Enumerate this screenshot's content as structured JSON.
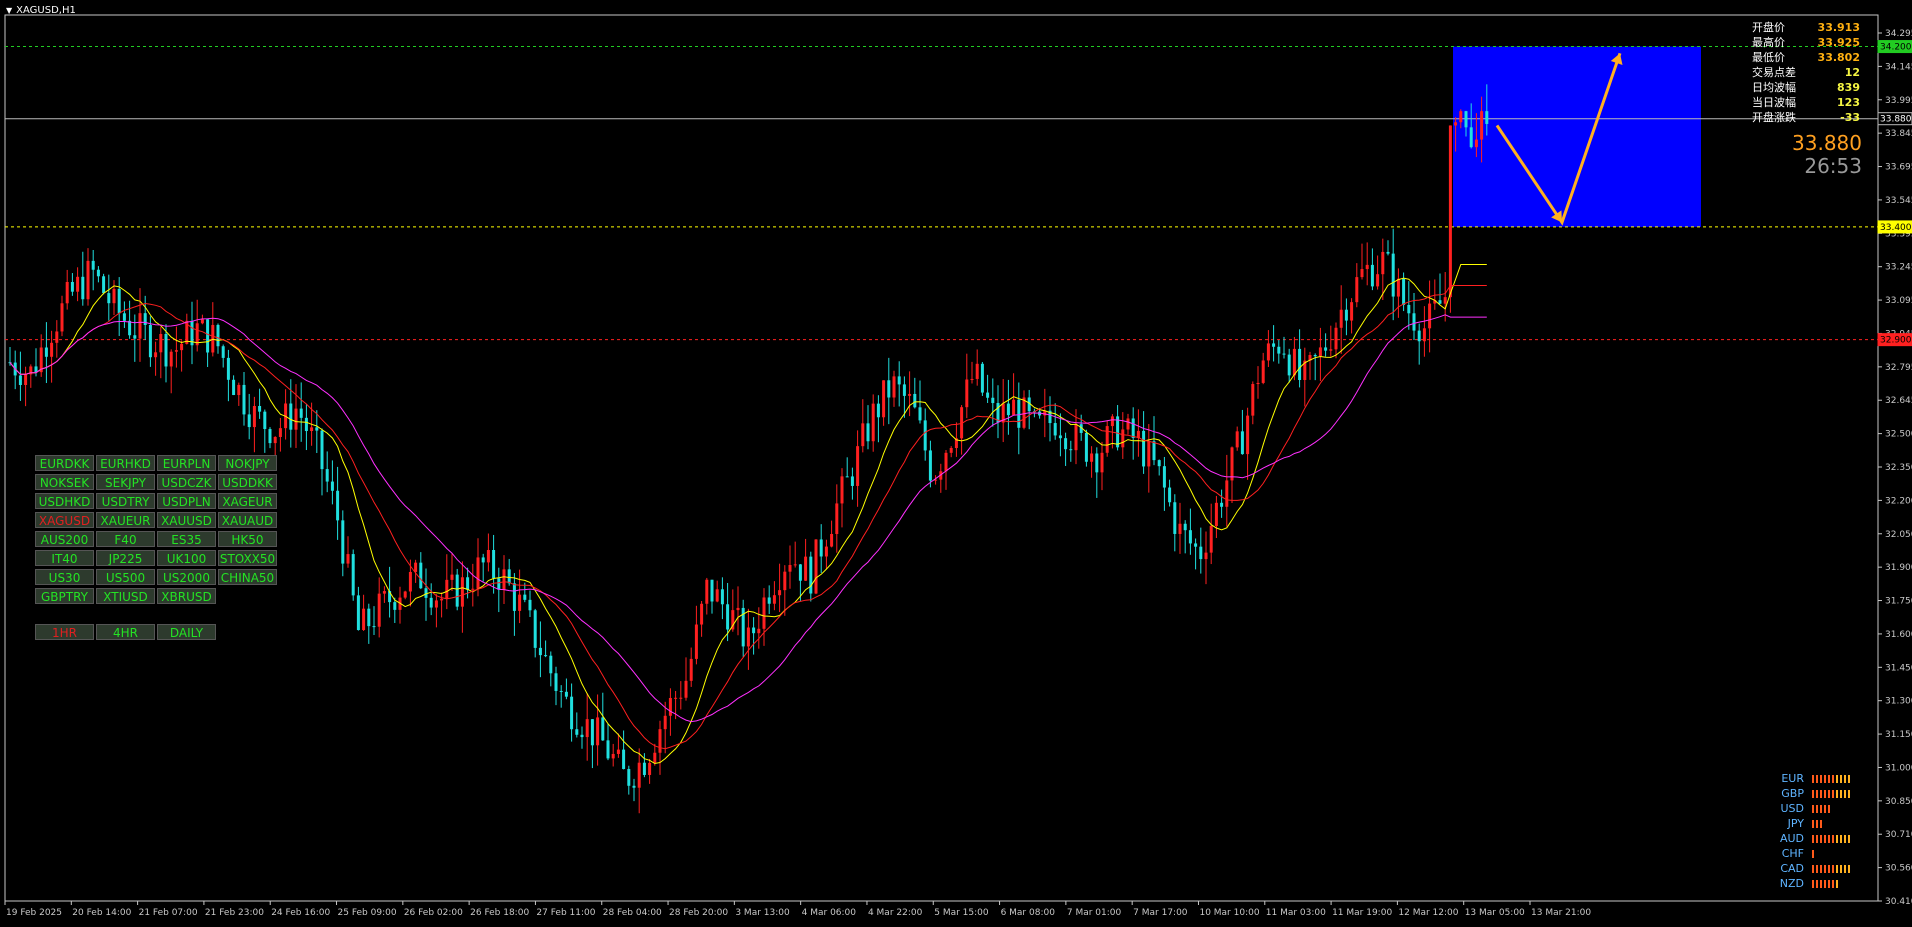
{
  "window": {
    "title": "XAGUSD,H1"
  },
  "info_panel": {
    "rows": [
      {
        "label": "开盘价",
        "value": "33.913",
        "color": "#ffb010"
      },
      {
        "label": "最高价",
        "value": "33.925",
        "color": "#ffb010"
      },
      {
        "label": "最低价",
        "value": "33.802",
        "color": "#ffb010"
      },
      {
        "label": "交易点差",
        "value": "12",
        "color": "#f5f542"
      },
      {
        "label": "日均波幅",
        "value": "839",
        "color": "#f5f542"
      },
      {
        "label": "当日波幅",
        "value": "123",
        "color": "#f5f542"
      },
      {
        "label": "开盘涨跌",
        "value": "-33",
        "color": "#f5f542"
      }
    ],
    "current_price": "33.880",
    "bar_timer": "26:53"
  },
  "symbols": [
    "EURDKK",
    "EURHKD",
    "EURPLN",
    "NOKJPY",
    "NOKSEK",
    "SEKJPY",
    "USDCZK",
    "USDDKK",
    "USDHKD",
    "USDTRY",
    "USDPLN",
    "XAGEUR",
    "XAGUSD",
    "XAUEUR",
    "XAUUSD",
    "XAUAUD",
    "AUS200",
    "F40",
    "ES35",
    "HK50",
    "IT40",
    "JP225",
    "UK100",
    "STOXX50",
    "US30",
    "US500",
    "US2000",
    "CHINA50",
    "GBPTRY",
    "XTIUSD",
    "XBRUSD"
  ],
  "active_symbol": "XAGUSD",
  "timeframes": [
    "1HR",
    "4HR",
    "DAILY"
  ],
  "active_timeframe": "1HR",
  "currency_strength": [
    {
      "name": "EUR",
      "level": 10
    },
    {
      "name": "GBP",
      "level": 10
    },
    {
      "name": "USD",
      "level": 5
    },
    {
      "name": "JPY",
      "level": 3
    },
    {
      "name": "AUD",
      "level": 10
    },
    {
      "name": "CHF",
      "level": 1
    },
    {
      "name": "CAD",
      "level": 10
    },
    {
      "name": "NZD",
      "level": 7
    }
  ],
  "chart_data": {
    "type": "candlestick",
    "symbol": "XAGUSD",
    "timeframe": "H1",
    "ylim": [
      30.41,
      34.34
    ],
    "y_ticks": [
      "34.295",
      "34.145",
      "33.995",
      "33.845",
      "33.695",
      "33.545",
      "33.395",
      "33.245",
      "33.095",
      "32.945",
      "32.795",
      "32.645",
      "32.500",
      "32.350",
      "32.200",
      "32.050",
      "31.900",
      "31.750",
      "31.600",
      "31.450",
      "31.300",
      "31.150",
      "31.000",
      "30.850",
      "30.710",
      "30.560",
      "30.410"
    ],
    "x_ticks": [
      "19 Feb 2025",
      "20 Feb 14:00",
      "21 Feb 07:00",
      "21 Feb 23:00",
      "24 Feb 16:00",
      "25 Feb 09:00",
      "26 Feb 02:00",
      "26 Feb 18:00",
      "27 Feb 11:00",
      "28 Feb 04:00",
      "28 Feb 20:00",
      "3 Mar 13:00",
      "4 Mar 06:00",
      "4 Mar 22:00",
      "5 Mar 15:00",
      "6 Mar 08:00",
      "7 Mar 01:00",
      "7 Mar 17:00",
      "10 Mar 10:00",
      "11 Mar 03:00",
      "11 Mar 19:00",
      "12 Mar 12:00",
      "13 Mar 05:00",
      "13 Mar 21:00"
    ],
    "price_path": [
      32.8,
      32.75,
      32.95,
      33.1,
      33.2,
      33.05,
      32.95,
      32.9,
      32.85,
      32.95,
      32.9,
      32.7,
      32.55,
      32.5,
      32.6,
      32.4,
      32.1,
      31.6,
      31.7,
      31.8,
      31.85,
      31.75,
      31.8,
      31.9,
      31.85,
      31.7,
      31.5,
      31.3,
      31.2,
      31.1,
      30.95,
      31.05,
      31.25,
      31.4,
      31.8,
      31.7,
      31.55,
      31.8,
      31.95,
      31.85,
      32.1,
      32.3,
      32.55,
      32.7,
      32.6,
      32.3,
      32.5,
      32.75,
      32.55,
      32.6,
      32.5,
      32.55,
      32.45,
      32.4,
      32.5,
      32.45,
      32.3,
      32.05,
      31.95,
      32.2,
      32.45,
      32.8,
      32.9,
      32.7,
      32.85,
      33.05,
      33.2,
      33.25,
      33.05,
      32.95,
      33.1,
      33.95,
      33.85
    ],
    "moving_averages": [
      {
        "name": "MA yellow",
        "color": "#ffff00",
        "lag": 10
      },
      {
        "name": "MA red",
        "color": "#ff2020",
        "lag": 18
      },
      {
        "name": "MA magenta",
        "color": "#ff30ff",
        "lag": 30
      }
    ],
    "horizontal_lines": [
      {
        "price": 34.2,
        "label": "34.200",
        "color": "#22cc22",
        "style": "dashed"
      },
      {
        "price": 33.88,
        "label": "33.880",
        "color": "#bbbbbb",
        "style": "solid"
      },
      {
        "price": 33.4,
        "label": "33.400",
        "color": "#ffff00",
        "style": "dashed"
      },
      {
        "price": 32.9,
        "label": "32.900",
        "color": "#ff2020",
        "style": "dashed"
      }
    ],
    "zone": {
      "top": 34.2,
      "bottom": 33.4,
      "color": "#0000ff"
    },
    "projection_arrow": {
      "color": "#ffb020",
      "points": [
        [
          33.85,
          0
        ],
        [
          33.42,
          1
        ],
        [
          34.17,
          2
        ]
      ]
    },
    "bull_color": "#ff2020",
    "bear_color": "#20e0e0",
    "grid": false
  }
}
